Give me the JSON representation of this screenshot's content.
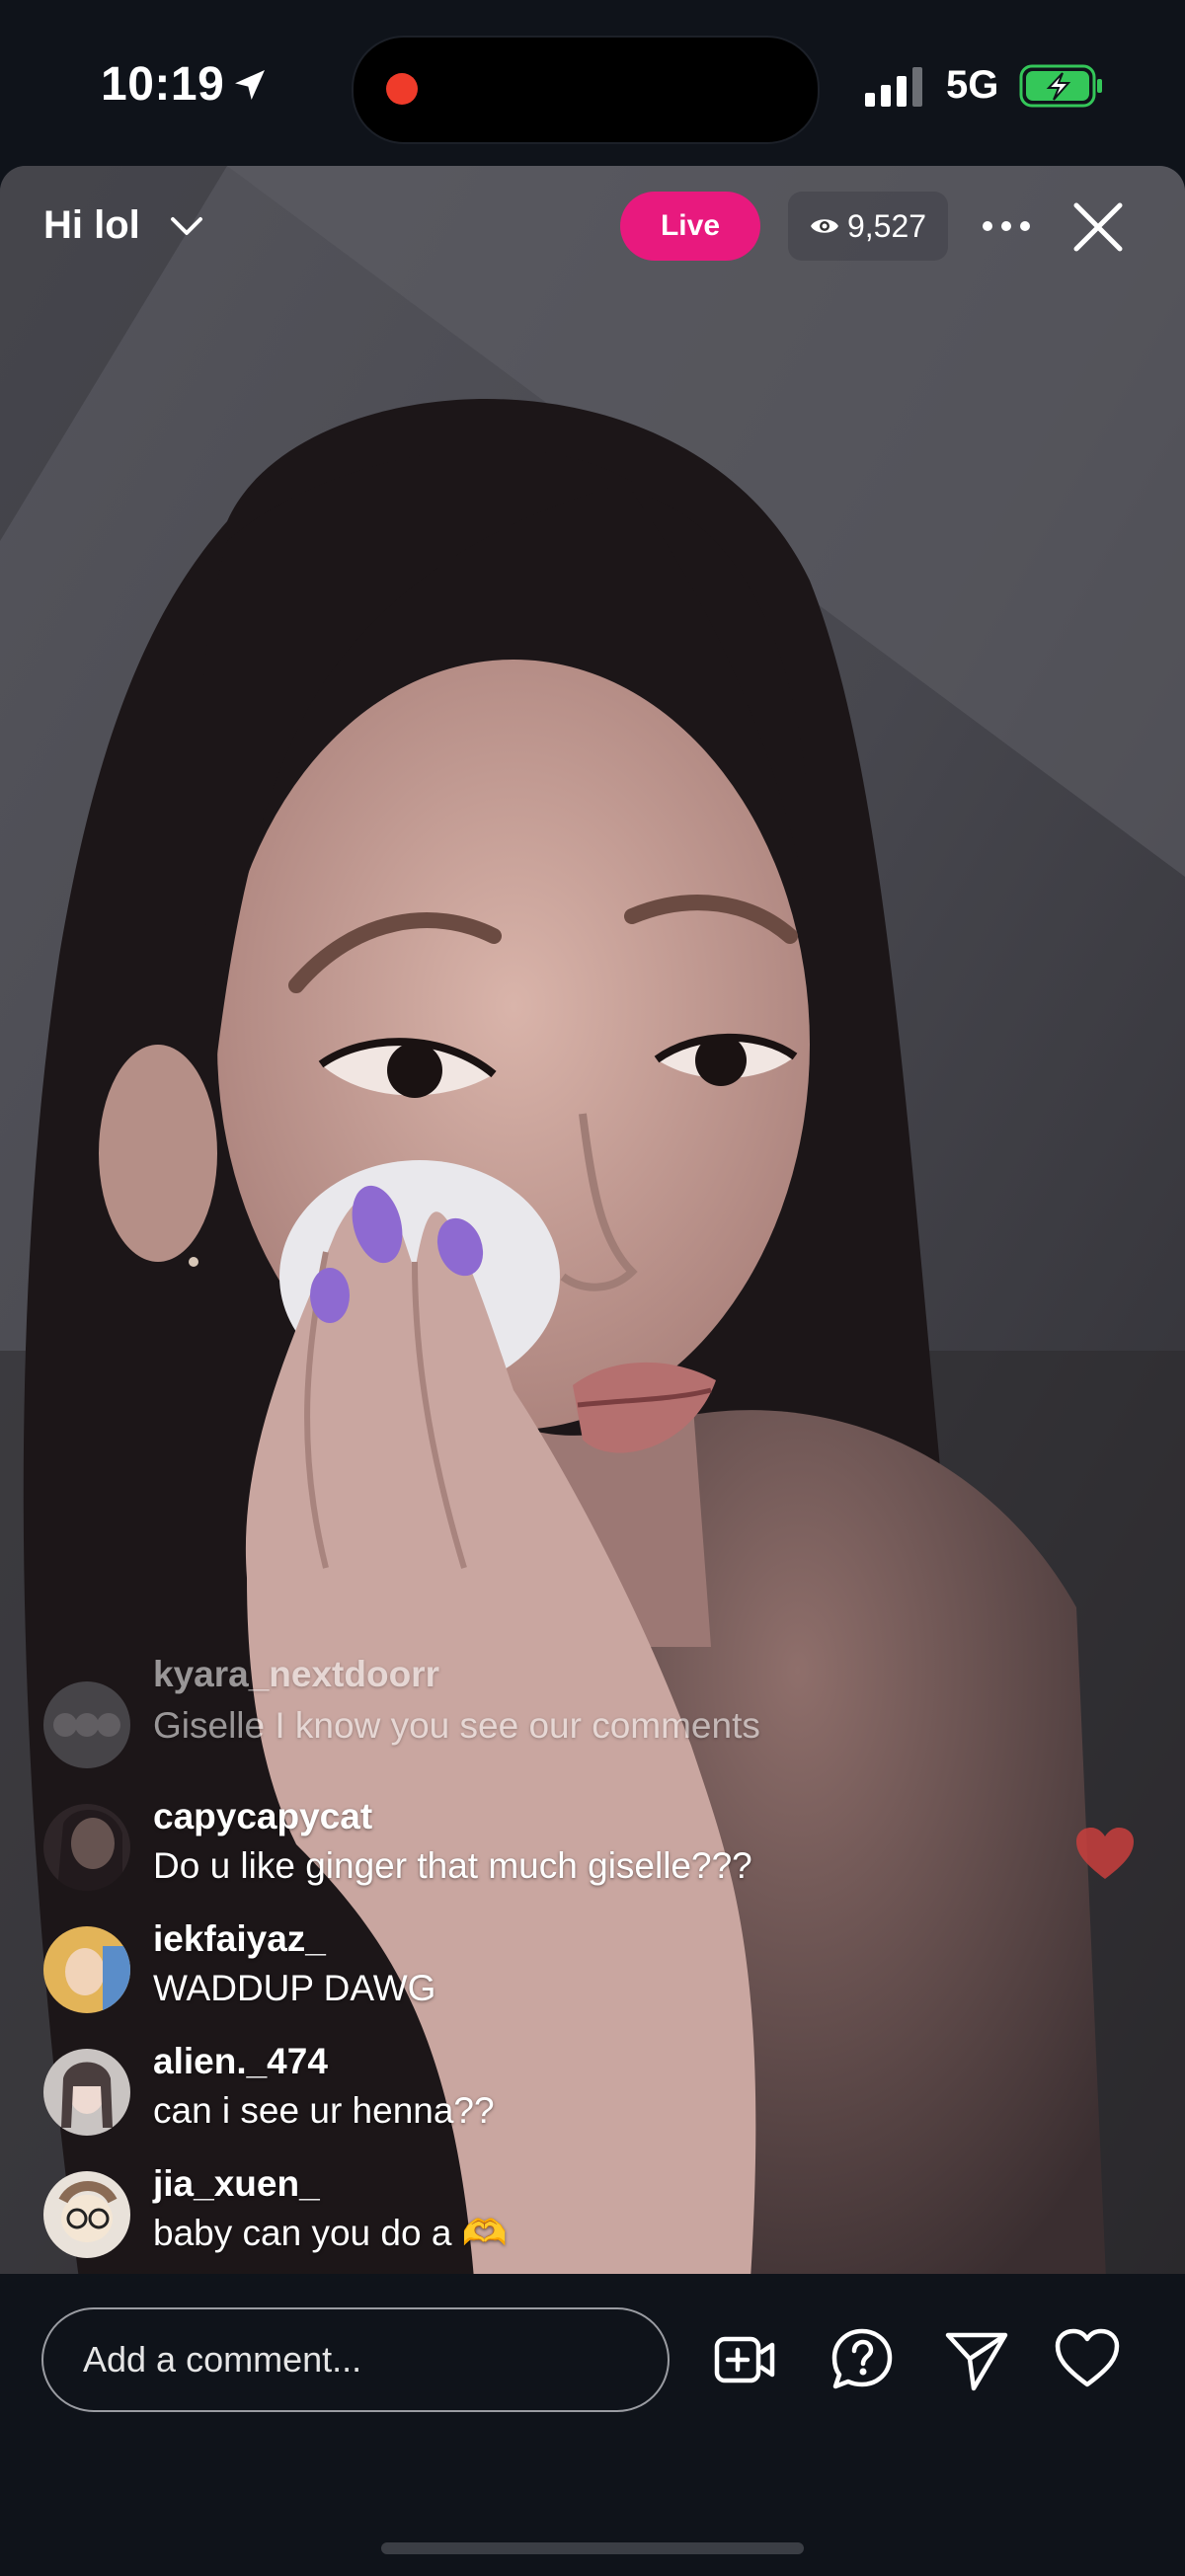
{
  "status_bar": {
    "time": "10:19",
    "network": "5G",
    "icons": [
      "location-arrow-icon",
      "recording-dot-icon",
      "signal-bars-icon",
      "battery-charging-icon"
    ],
    "battery_color": "#34c759"
  },
  "live": {
    "title": "Hi lol",
    "badge": "Live",
    "viewer_count": "9,527",
    "badge_color": "#e8197e",
    "icons": [
      "chevron-down-icon",
      "eye-icon",
      "more-icon",
      "close-icon"
    ]
  },
  "comments": [
    {
      "user": "kyara_nextdoorr",
      "text": "Giselle I know you see our comments"
    },
    {
      "user": "capycapycat",
      "text": "Do u like ginger that much giselle???"
    },
    {
      "user": "iekfaiyaz_",
      "text": "WADDUP DAWG"
    },
    {
      "user": "alien._474",
      "text": "can i see ur henna??"
    },
    {
      "user": "jia_xuen_",
      "text": "baby can you do a",
      "emoji": "🫶"
    }
  ],
  "bottom_bar": {
    "comment_placeholder": "Add a comment...",
    "actions": [
      "add-video-guest-icon",
      "question-icon",
      "share-icon",
      "heart-icon"
    ]
  }
}
